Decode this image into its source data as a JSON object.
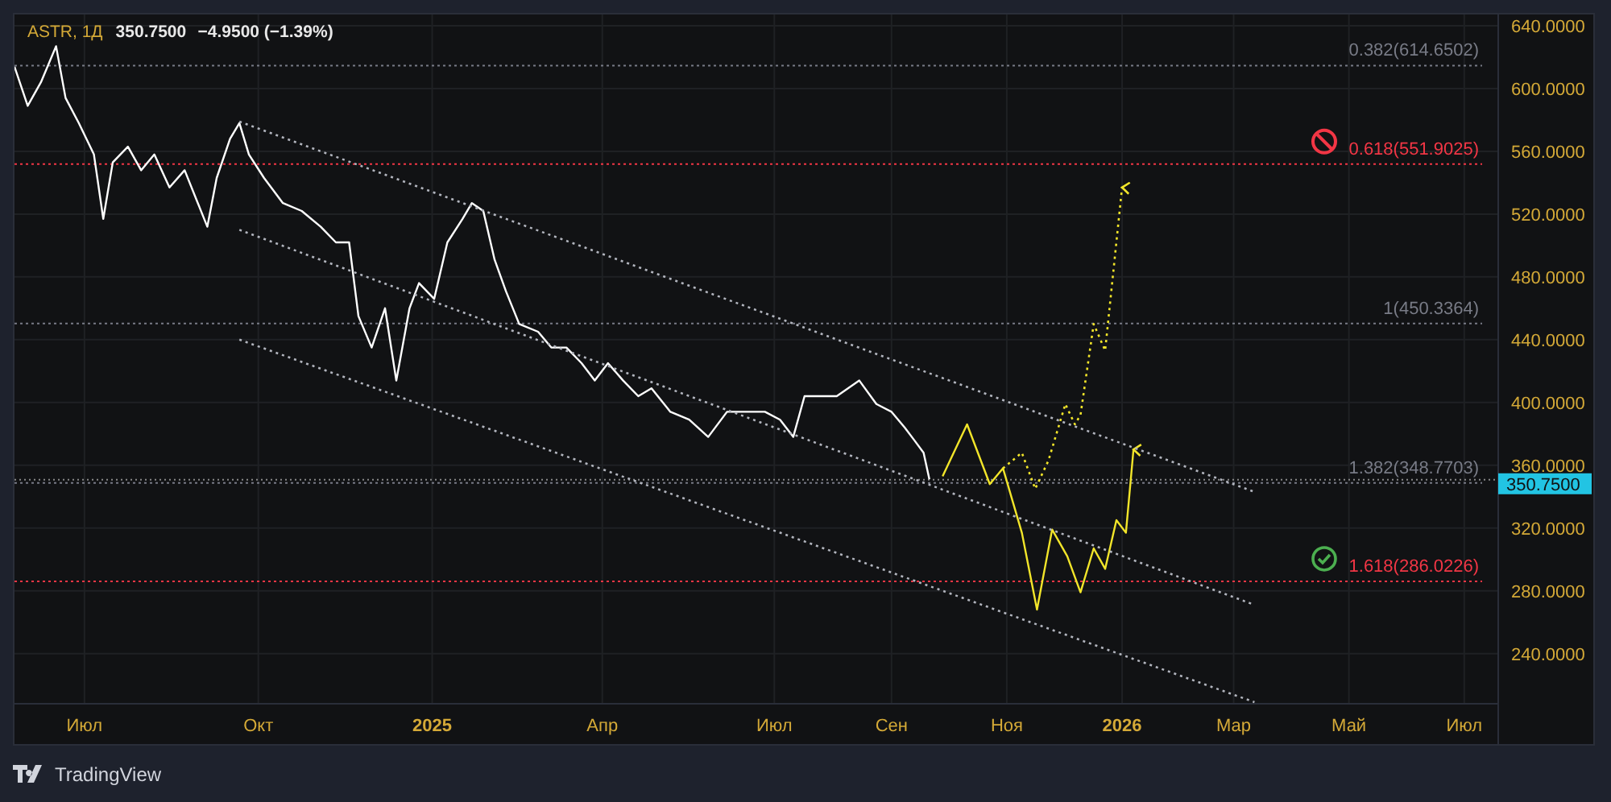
{
  "header": {
    "symbol": "ASTR, 1Д",
    "price": "350.7500",
    "change": "−4.9500 (−1.39%)"
  },
  "chart": {
    "chart_data": {
      "type": "line",
      "grid": true,
      "x": [
        "2024-05-25",
        "2024-06-01",
        "2024-06-08",
        "2024-06-16",
        "2024-06-21",
        "2024-06-28",
        "2024-07-06",
        "2024-07-11",
        "2024-07-16",
        "2024-07-24",
        "2024-07-31",
        "2024-08-07",
        "2024-08-15",
        "2024-08-23",
        "2024-08-30",
        "2024-09-04",
        "2024-09-09",
        "2024-09-16",
        "2024-09-21",
        "2024-09-26",
        "2024-10-04",
        "2024-10-14",
        "2024-10-24",
        "2024-11-03",
        "2024-11-11",
        "2024-11-18",
        "2024-11-23",
        "2024-11-30",
        "2024-12-07",
        "2024-12-13",
        "2024-12-20",
        "2024-12-25",
        "2025-01-02",
        "2025-01-09",
        "2025-01-17",
        "2025-01-22",
        "2025-01-28",
        "2025-02-03",
        "2025-02-09",
        "2025-02-16",
        "2025-02-26",
        "2025-03-05",
        "2025-03-13",
        "2025-03-21",
        "2025-03-28",
        "2025-04-04",
        "2025-04-12",
        "2025-04-20",
        "2025-04-27",
        "2025-05-07",
        "2025-05-17",
        "2025-05-27",
        "2025-06-06",
        "2025-06-16",
        "2025-06-26",
        "2025-07-04",
        "2025-07-11",
        "2025-07-17",
        "2025-07-25",
        "2025-08-03",
        "2025-08-09",
        "2025-08-15",
        "2025-08-24",
        "2025-09-01",
        "2025-09-08",
        "2025-09-13",
        "2025-09-18",
        "2025-09-21",
        "2025-09-28",
        "2025-10-11",
        "2025-10-23",
        "2025-10-30",
        "2025-11-09",
        "2025-11-16",
        "2025-11-17",
        "2025-11-23",
        "2025-11-25",
        "2025-12-02",
        "2025-12-03",
        "2025-12-07",
        "2025-12-10",
        "2025-12-17",
        "2025-12-23",
        "2025-12-29",
        "2026-01-01",
        "2026-01-03",
        "2026-01-07",
        "2026-03-12"
      ],
      "series": [
        {
          "color": "#ffffff",
          "line_style": "solid",
          "values": [
            614,
            589,
            604,
            627,
            594,
            578,
            558,
            517,
            553,
            563,
            548,
            558,
            537,
            548,
            527,
            512,
            543,
            568,
            578,
            558,
            543,
            527,
            522,
            512,
            502,
            502,
            455,
            435,
            460,
            414,
            460,
            476,
            466,
            502,
            517,
            527,
            522,
            491,
            471,
            450,
            445,
            435,
            435,
            425,
            414,
            425,
            414,
            404,
            409,
            394,
            389,
            378,
            394,
            394,
            394,
            389,
            378,
            404,
            404,
            404,
            409,
            414,
            399,
            394,
            384,
            376,
            368,
            351,
            null,
            null,
            null,
            null,
            null,
            null,
            null,
            null,
            null,
            null,
            null,
            null,
            null,
            null,
            null,
            null,
            null,
            null,
            null,
            null
          ]
        },
        {
          "color": "#f2e52a",
          "line_style": "solid",
          "values": [
            null,
            null,
            null,
            null,
            null,
            null,
            null,
            null,
            null,
            null,
            null,
            null,
            null,
            null,
            null,
            null,
            null,
            null,
            null,
            null,
            null,
            null,
            null,
            null,
            null,
            null,
            null,
            null,
            null,
            null,
            null,
            null,
            null,
            null,
            null,
            null,
            null,
            null,
            null,
            null,
            null,
            null,
            null,
            null,
            null,
            null,
            null,
            null,
            null,
            null,
            null,
            null,
            null,
            null,
            null,
            null,
            null,
            null,
            null,
            null,
            null,
            null,
            null,
            null,
            null,
            null,
            null,
            null,
            353,
            386,
            348,
            358,
            317,
            null,
            268,
            null,
            319,
            null,
            302,
            null,
            279,
            307,
            294,
            325,
            null,
            317,
            370,
            null
          ]
        },
        {
          "color": "#f2e52a",
          "line_style": "dotted",
          "values": [
            null,
            null,
            null,
            null,
            null,
            null,
            null,
            null,
            null,
            null,
            null,
            null,
            null,
            null,
            null,
            null,
            null,
            null,
            null,
            null,
            null,
            null,
            null,
            null,
            null,
            null,
            null,
            null,
            null,
            null,
            null,
            null,
            null,
            null,
            null,
            null,
            null,
            null,
            null,
            null,
            null,
            null,
            null,
            null,
            null,
            null,
            null,
            null,
            null,
            null,
            null,
            null,
            null,
            null,
            null,
            null,
            null,
            null,
            null,
            null,
            null,
            null,
            null,
            null,
            null,
            null,
            null,
            null,
            null,
            null,
            null,
            358,
            368,
            345,
            null,
            363,
            null,
            399,
            null,
            386,
            392,
            450,
            433,
            null,
            537,
            null,
            null,
            null
          ]
        },
        {
          "color": "#b2b5be",
          "line_style": "dotted",
          "values": [
            null,
            null,
            null,
            null,
            null,
            null,
            null,
            null,
            null,
            null,
            null,
            null,
            null,
            null,
            null,
            null,
            null,
            null,
            579,
            null,
            null,
            null,
            null,
            null,
            null,
            null,
            null,
            null,
            null,
            null,
            null,
            null,
            null,
            null,
            null,
            null,
            null,
            null,
            null,
            null,
            null,
            null,
            null,
            null,
            null,
            null,
            null,
            null,
            null,
            null,
            null,
            null,
            null,
            null,
            null,
            null,
            null,
            null,
            null,
            null,
            null,
            null,
            null,
            null,
            null,
            null,
            null,
            null,
            null,
            null,
            null,
            null,
            null,
            null,
            null,
            null,
            null,
            null,
            null,
            null,
            null,
            null,
            null,
            null,
            null,
            null,
            null,
            343
          ]
        },
        {
          "color": "#b2b5be",
          "line_style": "dotted",
          "values": [
            null,
            null,
            null,
            null,
            null,
            null,
            null,
            null,
            null,
            null,
            null,
            null,
            null,
            null,
            null,
            null,
            null,
            null,
            510,
            null,
            null,
            null,
            null,
            null,
            null,
            null,
            null,
            null,
            null,
            null,
            null,
            null,
            null,
            null,
            null,
            null,
            null,
            null,
            null,
            null,
            null,
            null,
            null,
            null,
            null,
            null,
            null,
            null,
            null,
            null,
            null,
            null,
            null,
            null,
            null,
            null,
            null,
            null,
            null,
            null,
            null,
            null,
            null,
            null,
            null,
            null,
            null,
            null,
            null,
            null,
            null,
            null,
            null,
            null,
            null,
            null,
            null,
            null,
            null,
            null,
            null,
            null,
            null,
            null,
            null,
            null,
            null,
            271
          ]
        },
        {
          "color": "#b2b5be",
          "line_style": "dotted",
          "values": [
            null,
            null,
            null,
            null,
            null,
            null,
            null,
            null,
            null,
            null,
            null,
            null,
            null,
            null,
            null,
            null,
            null,
            null,
            440,
            null,
            null,
            null,
            null,
            null,
            null,
            null,
            null,
            null,
            null,
            null,
            null,
            null,
            null,
            null,
            null,
            null,
            null,
            null,
            null,
            null,
            null,
            null,
            null,
            null,
            null,
            null,
            null,
            null,
            null,
            null,
            null,
            null,
            null,
            null,
            null,
            null,
            null,
            null,
            null,
            null,
            null,
            null,
            null,
            null,
            null,
            null,
            null,
            null,
            null,
            null,
            null,
            null,
            null,
            null,
            null,
            null,
            null,
            null,
            null,
            null,
            null,
            null,
            null,
            null,
            null,
            null,
            null,
            209
          ]
        }
      ],
      "xlim": [
        "2024-05-25",
        "2026-07-19"
      ],
      "ylim": [
        208,
        647.2
      ],
      "xticks": [
        {
          "value": "2024-07-01",
          "label": "Июл"
        },
        {
          "value": "2024-10-01",
          "label": "Окт"
        },
        {
          "value": "2025-01-01",
          "label": "2025"
        },
        {
          "value": "2025-04-01",
          "label": "Апр"
        },
        {
          "value": "2025-07-01",
          "label": "Июл"
        },
        {
          "value": "2025-09-01",
          "label": "Сен"
        },
        {
          "value": "2025-11-01",
          "label": "Ноя"
        },
        {
          "value": "2026-01-01",
          "label": "2026"
        },
        {
          "value": "2026-03-01",
          "label": "Мар"
        },
        {
          "value": "2026-05-01",
          "label": "Май"
        },
        {
          "value": "2026-07-01",
          "label": "Июл"
        }
      ],
      "yticks": [
        {
          "value": 640,
          "label": "640.0000"
        },
        {
          "value": 600,
          "label": "600.0000"
        },
        {
          "value": 560,
          "label": "560.0000"
        },
        {
          "value": 520,
          "label": "520.0000"
        },
        {
          "value": 480,
          "label": "480.0000"
        },
        {
          "value": 440,
          "label": "440.0000"
        },
        {
          "value": 400,
          "label": "400.0000"
        },
        {
          "value": 360,
          "label": "360.0000"
        },
        {
          "value": 320,
          "label": "320.0000"
        },
        {
          "value": 280,
          "label": "280.0000"
        },
        {
          "value": 240,
          "label": "240.0000"
        }
      ],
      "ref_lines": [
        {
          "axis": "y",
          "value": 614.6502,
          "label": "0.382(614.6502)",
          "color": "#787b86"
        },
        {
          "axis": "y",
          "value": 551.9025,
          "label": "0.618(551.9025)",
          "color": "#f23645"
        },
        {
          "axis": "y",
          "value": 450.3364,
          "label": "1(450.3364)",
          "color": "#787b86"
        },
        {
          "axis": "y",
          "value": 348.7703,
          "label": "1.382(348.7703)",
          "color": "#787b86"
        },
        {
          "axis": "y",
          "value": 286.0226,
          "label": "1.618(286.0226)",
          "color": "#f23645"
        },
        {
          "axis": "y",
          "value": 350.75,
          "label": "350.7500",
          "color": "#888888"
        }
      ]
    }
  },
  "footer": {
    "brand": "TradingView"
  }
}
